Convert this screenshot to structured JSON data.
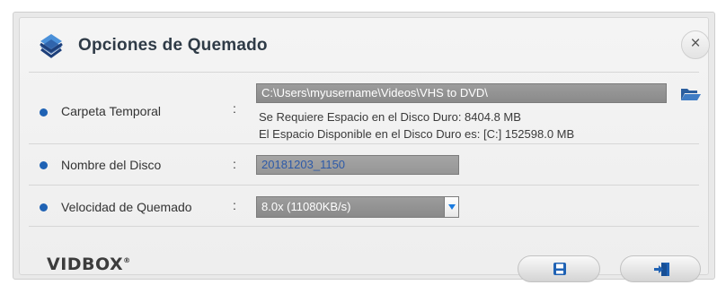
{
  "dialog": {
    "title": "Opciones de Quemado",
    "close_label": "×"
  },
  "temp_folder": {
    "label": "Carpeta Temporal",
    "colon": ":",
    "path": "C:\\Users\\myusername\\Videos\\VHS to DVD\\",
    "required_space": "Se Requiere Espacio en el Disco Duro: 8404.8 MB",
    "available_space": "El Espacio Disponible en el Disco Duro es: [C:] 152598.0 MB"
  },
  "disc_name": {
    "label": "Nombre del Disco",
    "colon": ":",
    "value": "20181203_1150"
  },
  "burn_speed": {
    "label": "Velocidad de Quemado",
    "colon": ":",
    "selected": "8.0x (11080KB/s)"
  },
  "footer": {
    "brand": "VIDBOX",
    "brand_mark": "®"
  },
  "colors": {
    "accent_blue": "#1f62b4",
    "arrow_blue": "#1a7be0"
  },
  "icons": {
    "header": "layers-logo-icon",
    "folder": "folder-open-icon",
    "save": "save-icon",
    "exit": "exit-icon"
  }
}
